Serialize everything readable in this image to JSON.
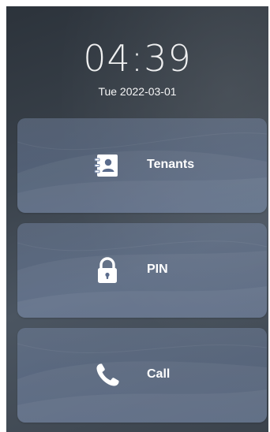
{
  "status": {
    "time": "04:39",
    "date": "Tue 2022-03-01"
  },
  "menu": {
    "items": [
      {
        "label": "Tenants",
        "icon": "contacts-book-icon"
      },
      {
        "label": "PIN",
        "icon": "lock-icon"
      },
      {
        "label": "Call",
        "icon": "phone-icon"
      }
    ]
  },
  "colors": {
    "background": "#3a424b",
    "card": "#6e82a6",
    "text": "#ffffff"
  }
}
